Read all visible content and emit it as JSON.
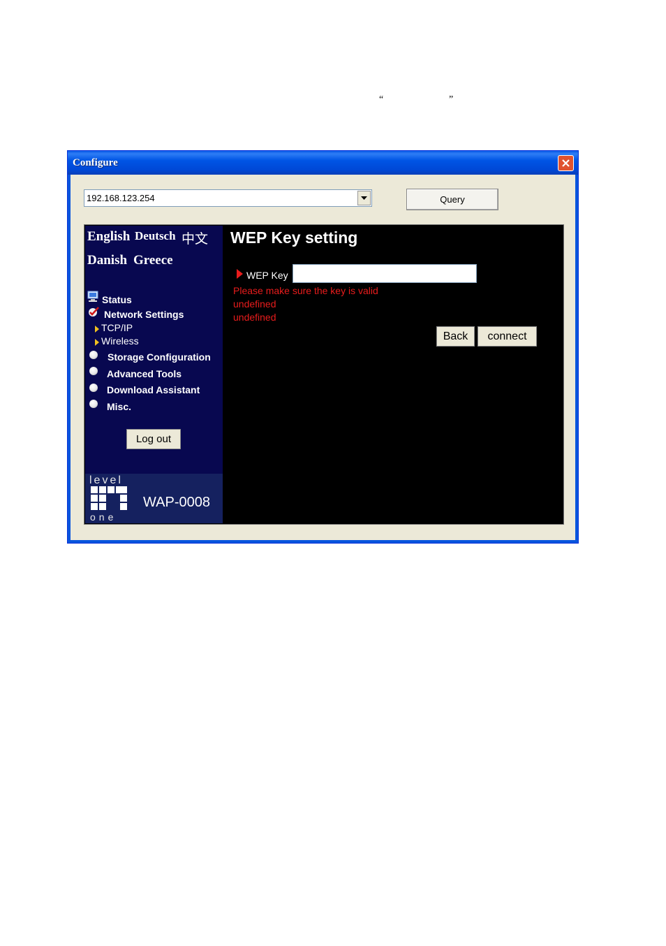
{
  "doc": {
    "open_quote": "“",
    "close_quote": "”"
  },
  "window": {
    "title": "Configure"
  },
  "toolbar": {
    "ip_value": "192.168.123.254",
    "query_label": "Query"
  },
  "languages": {
    "english": "English",
    "deutsch": "Deutsch",
    "chinese": "中文",
    "danish": "Danish",
    "greece": "Greece"
  },
  "nav": {
    "status": "Status",
    "network_settings": "Network Settings",
    "tcpip": "TCP/IP",
    "wireless": "Wireless",
    "storage": "Storage Configuration",
    "advanced": "Advanced Tools",
    "download": "Download Assistant",
    "misc": "Misc.",
    "logout": "Log out"
  },
  "brand": {
    "level": "level",
    "one": "one",
    "model": "WAP-0008"
  },
  "content": {
    "title": "WEP Key setting",
    "wep_label": "WEP Key",
    "wep_value": "",
    "error_line1": "Please make sure the key is valid",
    "error_line2": "undefined",
    "error_line3": "undefined",
    "back_label": "Back",
    "connect_label": "connect"
  },
  "icons": {
    "close": "close-icon",
    "dropdown": "chevron-down-icon",
    "status": "monitor-icon",
    "network": "checkmark-icon",
    "sub_arrow": "triangle-right-icon",
    "bullet": "circle-bullet-icon",
    "red_arrow": "red-triangle-icon"
  },
  "colors": {
    "accent_red": "#e81c1c",
    "sidebar_bg": "#080850",
    "titlebar": "#0055e5"
  }
}
